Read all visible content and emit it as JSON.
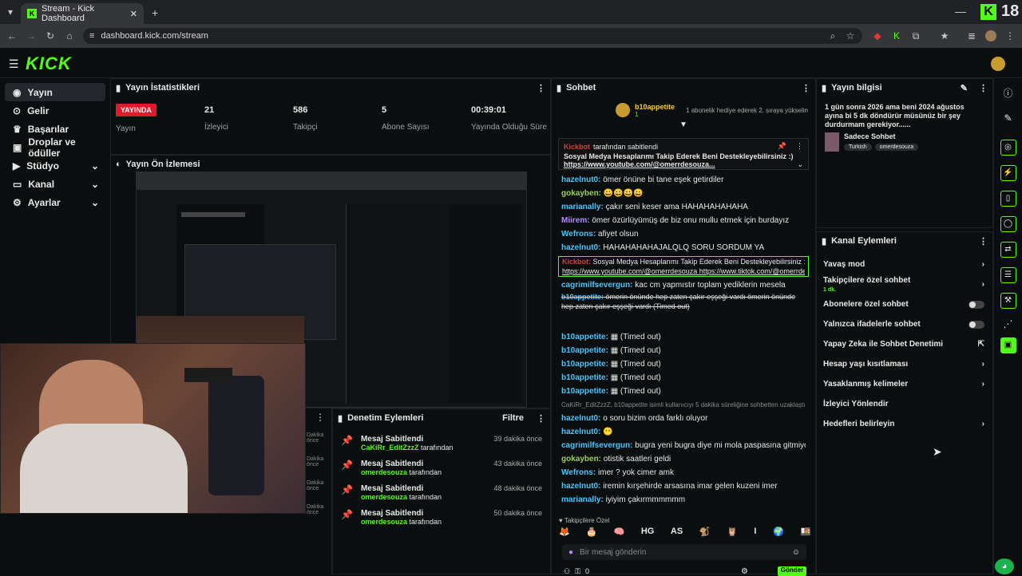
{
  "browser": {
    "tab_title": "Stream - Kick Dashboard",
    "url": "dashboard.kick.com/stream",
    "badge_number": "18"
  },
  "app": {
    "logo": "KICK"
  },
  "sidebar": {
    "items": [
      {
        "label": "Yayın",
        "icon": "broadcast-icon"
      },
      {
        "label": "Gelir",
        "icon": "money-icon"
      },
      {
        "label": "Başarılar",
        "icon": "trophy-icon"
      },
      {
        "label": "Droplar ve ödüller",
        "icon": "gift-icon"
      },
      {
        "label": "Stüdyo",
        "icon": "video-icon"
      },
      {
        "label": "Kanal",
        "icon": "channel-icon"
      },
      {
        "label": "Ayarlar",
        "icon": "gear-icon"
      }
    ]
  },
  "stats": {
    "title": "Yayın İstatistikleri",
    "live_badge": "YAYINDA",
    "status_label": "Yayın",
    "viewers": "21",
    "viewers_label": "İzleyici",
    "followers": "586",
    "followers_label": "Takipçi",
    "subs": "5",
    "subs_label": "Abone Sayısı",
    "uptime": "00:39:01",
    "uptime_label": "Yayında Olduğu Süre"
  },
  "preview": {
    "title": "Yayın Ön İzlemesi"
  },
  "moderation": {
    "title": "Denetim Eylemleri",
    "filter_label": "Filtre",
    "left_edge": [
      "Dakika önce",
      "Dakika önce",
      "Dakika önce",
      "Dakika önce"
    ],
    "items": [
      {
        "action": "Mesaj Sabitlendi",
        "by": "CaKiRr_EditZzzZ",
        "suffix": "tarafından",
        "time": "39 dakika önce"
      },
      {
        "action": "Mesaj Sabitlendi",
        "by": "omerdesouza",
        "suffix": "tarafından",
        "time": "43 dakika önce"
      },
      {
        "action": "Mesaj Sabitlendi",
        "by": "omerdesouza",
        "suffix": "tarafından",
        "time": "48 dakika önce"
      },
      {
        "action": "Mesaj Sabitlendi",
        "by": "omerdesouza",
        "suffix": "tarafından",
        "time": "50 dakika önce"
      }
    ]
  },
  "chat": {
    "title": "Sohbet",
    "gift_user": "b10appetite",
    "gift_count": "1",
    "gift_text": "1 abonelik hediye ederek 2. sıraya yükselin",
    "pinned": {
      "by": "Kickbot",
      "by_suffix": "tarafından sabitlendi",
      "text": "Sosyal Medya Hesaplarımı Takip Ederek Beni Destekleyebilirsiniz :)",
      "link": "https://www.youtube.com/@omerrdesouza..."
    },
    "messages": [
      {
        "user": "hazelnut0:",
        "color": "#4fc3f7",
        "text": "ömer önüne bi tane eşek getirdiler"
      },
      {
        "user": "gokayben:",
        "color": "#9ccc65",
        "text": "😀😀😀😀"
      },
      {
        "user": "marianally:",
        "color": "#4fc3f7",
        "text": "çakır seni keser ama HAHAHAHAHAHA"
      },
      {
        "user": "Miirem:",
        "color": "#b388ff",
        "text": "ömer özürlüyümüş de biz onu mullu etmek için burdayız"
      },
      {
        "user": "Wefrons:",
        "color": "#4fc3f7",
        "text": "afiyet olsun"
      },
      {
        "user": "hazelnut0:",
        "color": "#4fc3f7",
        "text": "HAHAHAHAHAJALQLQ SORU SORDUM YA"
      },
      {
        "user": "Kickbot:",
        "color": "#e53935",
        "text": "Sosyal Medya Hesaplarımı Takip Ederek Beni Destekleyebilirsiniz :)",
        "link": "https://www.youtube.com/@omerrdesouza https://www.tiktok.com/@omerrdesouza",
        "highlight": true
      },
      {
        "user": "cagrimilfsevergun:",
        "color": "#4fc3f7",
        "text": "kac cm yapmıstır toplam yediklerin mesela"
      },
      {
        "user": "b10appetite:",
        "color": "#4fc3f7",
        "text": "ömerin önünde hep zaten çakır eşşeği vardı ömerin önünde hep zaten çakır eşşeği vardı (Timed out)",
        "struck": true
      },
      {
        "user": "b10appetite:",
        "color": "#4fc3f7",
        "text": "(Timed out)"
      },
      {
        "user": "b10appetite:",
        "color": "#4fc3f7",
        "text": "(Timed out)"
      },
      {
        "user": "b10appetite:",
        "color": "#4fc3f7",
        "text": "(Timed out)"
      },
      {
        "user": "b10appetite:",
        "color": "#4fc3f7",
        "text": "(Timed out)"
      },
      {
        "user": "b10appetite:",
        "color": "#4fc3f7",
        "text": "(Timed out)"
      },
      {
        "user": "",
        "color": "#888",
        "text": "CaKiRr_EditZzzZ, b10appetite isimli kullanıcıyı 5 dakika süreliğine sohbetten uzaklaştırdı",
        "system": true
      },
      {
        "user": "hazelnut0:",
        "color": "#4fc3f7",
        "text": "o soru bizim orda farklı oluyor"
      },
      {
        "user": "hazelnut0:",
        "color": "#4fc3f7",
        "text": "😶"
      },
      {
        "user": "cagrimilfsevergun:",
        "color": "#4fc3f7",
        "text": "bugra yeni bugra diye mi mola paspasına gitmiyo artık"
      },
      {
        "user": "gokayben:",
        "color": "#9ccc65",
        "text": "otistik saatleri geldi"
      },
      {
        "user": "Wefrons:",
        "color": "#4fc3f7",
        "text": "imer ? yok cimer amk"
      },
      {
        "user": "hazelnut0:",
        "color": "#4fc3f7",
        "text": "iremin kırşehirde arsasına imar gelen kuzeni imer"
      },
      {
        "user": "marianally:",
        "color": "#4fc3f7",
        "text": "iyiyim çakırmmmmmm"
      }
    ],
    "emote_section": "Takipçilere Özel",
    "emotes": [
      "🦊",
      "🎂",
      "🧠",
      "HG",
      "AS",
      "🐒",
      "🦉",
      "I",
      "🌍",
      "🍱"
    ],
    "input_placeholder": "Bir mesaj gönderin",
    "footer_count": "0",
    "send_label": "Gönder"
  },
  "stream_info": {
    "title": "Yayın bilgisi",
    "description": "1 gün sonra 2026 ama beni 2024 ağustos ayına bi 5 dk döndürür müsünüz bir şey durdurmam gerekiyor......",
    "category": "Sadece Sohbet",
    "tags": [
      "Turkish",
      "omerdesouza"
    ]
  },
  "channel_actions": {
    "title": "Kanal Eylemleri",
    "items": [
      {
        "label": "Yavaş mod",
        "control": "arrow"
      },
      {
        "label": "Takipçilere özel sohbet",
        "sub": "1 dk.",
        "control": "arrow"
      },
      {
        "label": "Abonelere özel sohbet",
        "control": "toggle"
      },
      {
        "label": "Yalnızca ifadelerle sohbet",
        "control": "toggle"
      },
      {
        "label": "Yapay Zeka ile Sohbet Denetimi",
        "control": "external"
      },
      {
        "label": "Hesap yaşı kısıtlaması",
        "control": "arrow"
      },
      {
        "label": "Yasaklanmış kelimeler",
        "control": "arrow"
      },
      {
        "label": "İzleyici Yönlendir",
        "control": "none"
      },
      {
        "label": "Hedefleri belirleyin",
        "control": "arrow"
      }
    ]
  },
  "colors": {
    "brand": "#53fc18",
    "live": "#e0192b",
    "panel_bg": "#0b0e0f"
  }
}
